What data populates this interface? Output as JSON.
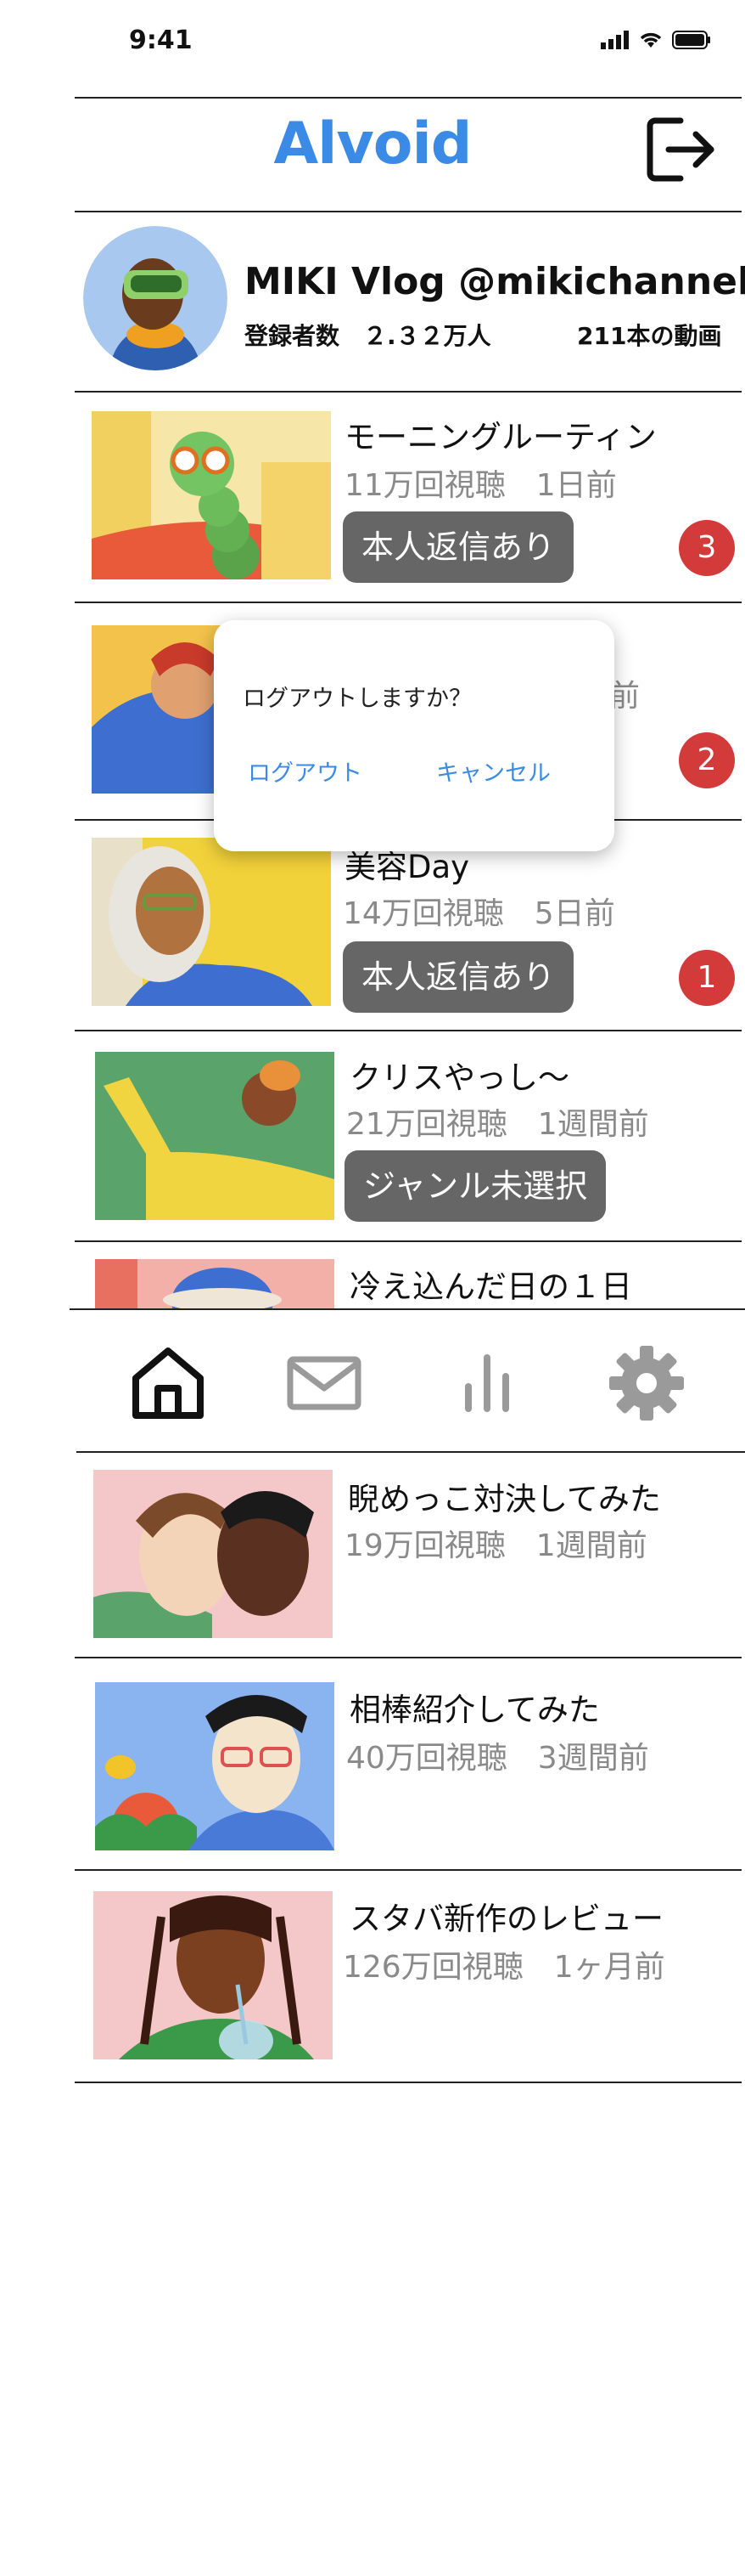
{
  "status": {
    "time": "9:41"
  },
  "app": {
    "title": "Alvoid"
  },
  "channel": {
    "name": "MIKI Vlog @mikichannel",
    "subscribers": "登録者数　２.３２万人",
    "videos_count": "211本の動画"
  },
  "videos": [
    {
      "title": "モーニングルーティン",
      "meta": "11万回視聴　1日前",
      "tag": "本人返信あり",
      "badge": "3"
    },
    {
      "title": "",
      "meta": "前",
      "tag": "",
      "badge": "2"
    },
    {
      "title": "美容Day",
      "meta": "14万回視聴　5日前",
      "tag": "本人返信あり",
      "badge": "1"
    },
    {
      "title": "クリスやっし〜",
      "meta": "21万回視聴　1週間前",
      "tag": "ジャンル未選択"
    },
    {
      "title": "冷え込んだ日の１日"
    },
    {
      "title": "睨めっこ対決してみた",
      "meta": "19万回視聴　1週間前"
    },
    {
      "title": "相棒紹介してみた",
      "meta": "40万回視聴　3週間前"
    },
    {
      "title": "スタバ新作のレビュー",
      "meta": "126万回視聴　1ヶ月前"
    }
  ],
  "dialog": {
    "message": "ログアウトしますか？",
    "confirm_label": "ログアウト",
    "cancel_label": "キャンセル"
  },
  "tabbar": {
    "icons": [
      "home-icon",
      "mail-icon",
      "analytics-icon",
      "settings-icon"
    ]
  },
  "colors": {
    "brand": "#3b8ae6",
    "badge": "#d33a3a",
    "tag": "#666666"
  }
}
